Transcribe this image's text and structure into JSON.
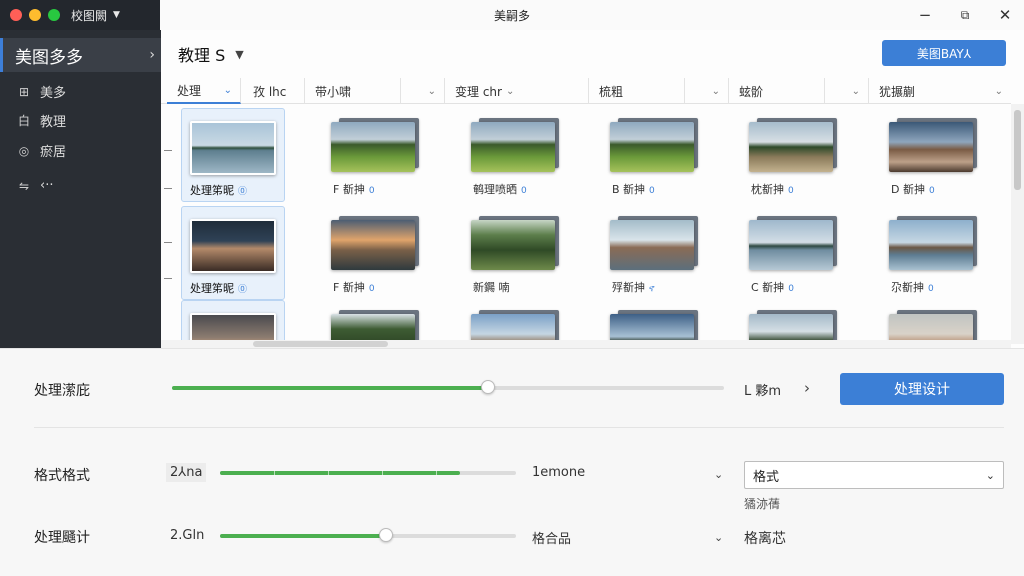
{
  "window": {
    "app_title": "校图闕",
    "center_title": "美嗣多",
    "traffic_lights": [
      "#ff5f57",
      "#febc2e",
      "#28c840"
    ]
  },
  "sidebar": {
    "header": "美图多多",
    "items": [
      {
        "icon": "grid-icon",
        "glyph": "⊞",
        "label": "美多"
      },
      {
        "icon": "text-icon",
        "glyph": "白",
        "label": "教理"
      },
      {
        "icon": "circle-icon",
        "glyph": "◎",
        "label": "瘀居"
      },
      {
        "icon": "link-icon",
        "glyph": "⇋",
        "label": "‹··"
      }
    ]
  },
  "header": {
    "folder_title": "教理 S",
    "top_button": "美图BAY⅄"
  },
  "columns": [
    {
      "label": "处理",
      "active": true
    },
    {
      "label": "孜 lhc",
      "active": false
    },
    {
      "label": "带小啸",
      "active": false
    },
    {
      "label": "",
      "active": false
    },
    {
      "label": "变理 chr",
      "active": false
    },
    {
      "label": "梳粗",
      "active": false
    },
    {
      "label": "",
      "active": false
    },
    {
      "label": "蚿骱",
      "active": false
    },
    {
      "label": "",
      "active": false
    },
    {
      "label": "犹搌蒯",
      "active": false
    }
  ],
  "grid": {
    "rows": [
      [
        {
          "label": "处理笫昵",
          "badge": "⓪",
          "scene": "lake",
          "selected": true
        },
        {
          "label": "F 斱抻",
          "badge": "0",
          "scene": "field"
        },
        {
          "label": "鹌理喷晒",
          "badge": "0",
          "scene": "field"
        },
        {
          "label": "B 斱抻",
          "badge": "0",
          "scene": "field"
        },
        {
          "label": "枕斱抻",
          "badge": "0",
          "scene": "road"
        },
        {
          "label": "D 斱抻",
          "badge": "0",
          "scene": "city"
        }
      ],
      [
        {
          "label": "处理笫昵",
          "badge": "⓪",
          "scene": "portrait",
          "selected": true
        },
        {
          "label": "F 斱抻",
          "badge": "0",
          "scene": "sunset"
        },
        {
          "label": "新鐊 喃",
          "badge": "",
          "scene": "forest"
        },
        {
          "label": "殍斱抻",
          "badge": "ኖ",
          "scene": "portrait2"
        },
        {
          "label": "C 斱抻",
          "badge": "0",
          "scene": "lake2"
        },
        {
          "label": "尕斱抻",
          "badge": "0",
          "scene": "pier"
        }
      ],
      [
        {
          "label": "",
          "badge": "",
          "scene": "portrait3",
          "selected": true
        },
        {
          "label": "",
          "badge": "",
          "scene": "forest2"
        },
        {
          "label": "",
          "badge": "",
          "scene": "ruins"
        },
        {
          "label": "",
          "badge": "",
          "scene": "lake3"
        },
        {
          "label": "",
          "badge": "",
          "scene": "trees"
        },
        {
          "label": "",
          "badge": "",
          "scene": "portrait4"
        }
      ]
    ]
  },
  "bottom": {
    "row1": {
      "label": "处理潆庇",
      "progress": 0.67,
      "value": "L 夥m",
      "arrow": "›",
      "button": "处理设计"
    },
    "row2": {
      "label": "格式格式",
      "prefix": "2⅄na",
      "progress": 0.9,
      "value": "1emone",
      "select": "格式",
      "select_caption": "獝洂蒨"
    },
    "row3": {
      "label": "处理颾计",
      "prefix": "2.Gln",
      "progress": 0.56,
      "value": "格合品",
      "right_text": "格离芯"
    }
  }
}
